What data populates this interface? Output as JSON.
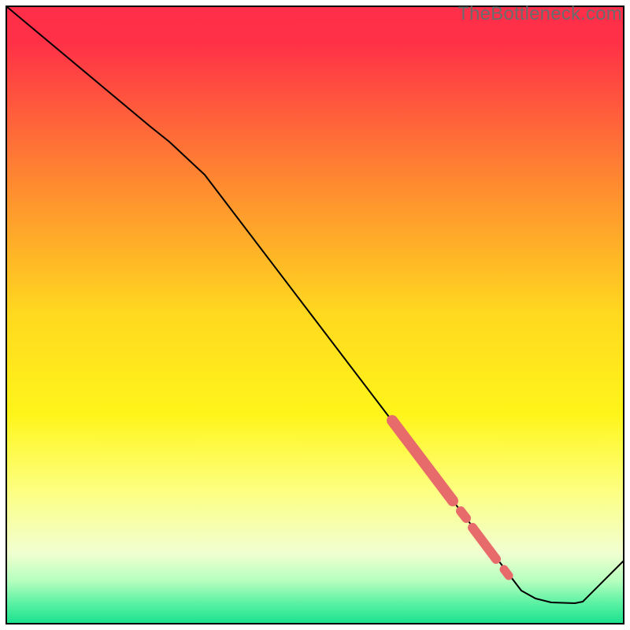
{
  "watermark": "TheBottleneck.com",
  "chart_data": {
    "type": "line",
    "title": "",
    "xlabel": "",
    "ylabel": "",
    "xlim": [
      8,
      792
    ],
    "ylim": [
      792,
      8
    ],
    "grid": false,
    "legend": false,
    "background_gradient_stops": [
      {
        "offset": 0.0,
        "color": "#ff2e4a"
      },
      {
        "offset": 0.06,
        "color": "#ff3147"
      },
      {
        "offset": 0.3,
        "color": "#ff8f2f"
      },
      {
        "offset": 0.5,
        "color": "#ffd91f"
      },
      {
        "offset": 0.66,
        "color": "#fff51a"
      },
      {
        "offset": 0.78,
        "color": "#fdff7d"
      },
      {
        "offset": 0.885,
        "color": "#f1ffd1"
      },
      {
        "offset": 0.93,
        "color": "#b7ffbe"
      },
      {
        "offset": 0.965,
        "color": "#5ff2a4"
      },
      {
        "offset": 1.0,
        "color": "#19e28e"
      }
    ],
    "series": [
      {
        "name": "bottleneck-curve",
        "stroke": "#000000",
        "stroke_width": 2,
        "points": [
          {
            "x": 8,
            "y": 8
          },
          {
            "x": 190,
            "y": 160
          },
          {
            "x": 215,
            "y": 180
          },
          {
            "x": 260,
            "y": 222
          },
          {
            "x": 662,
            "y": 750
          },
          {
            "x": 680,
            "y": 760
          },
          {
            "x": 700,
            "y": 765
          },
          {
            "x": 730,
            "y": 766
          },
          {
            "x": 740,
            "y": 764
          },
          {
            "x": 792,
            "y": 712
          }
        ]
      }
    ],
    "markers": {
      "color": "#e86b6b",
      "segments": [
        {
          "x1": 498,
          "y1": 534,
          "x2": 575,
          "y2": 636,
          "width": 14
        },
        {
          "x1": 585,
          "y1": 649,
          "x2": 592,
          "y2": 658,
          "width": 12
        },
        {
          "x1": 600,
          "y1": 670,
          "x2": 630,
          "y2": 710,
          "width": 12
        },
        {
          "x1": 640,
          "y1": 723,
          "x2": 646,
          "y2": 731,
          "width": 11
        }
      ]
    },
    "border": {
      "color": "#000000",
      "width": 2,
      "inset": 8
    }
  }
}
